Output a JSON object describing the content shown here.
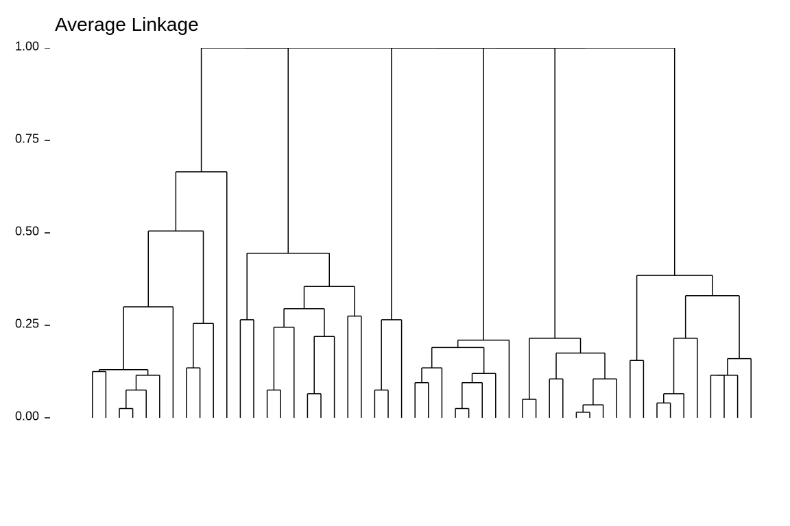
{
  "chart_data": {
    "type": "dendrogram",
    "title": "Average Linkage",
    "ylabel": "",
    "xlabel": "",
    "ylim": [
      0,
      1.0
    ],
    "yticks": [
      0.0,
      0.25,
      0.5,
      0.75,
      1.0
    ],
    "ytick_labels": [
      "0.00",
      "0.25",
      "0.50",
      "0.75",
      "1.00"
    ],
    "n_leaves": 50,
    "merges": [
      {
        "id": "m0",
        "children": [
          "L0",
          "L1"
        ],
        "height": 0.125
      },
      {
        "id": "m1",
        "children": [
          "L2",
          "L3"
        ],
        "height": 0.025
      },
      {
        "id": "m2",
        "children": [
          "m1",
          "L4"
        ],
        "height": 0.075
      },
      {
        "id": "m3",
        "children": [
          "m2",
          "L5"
        ],
        "height": 0.115
      },
      {
        "id": "m4",
        "children": [
          "m0",
          "m3"
        ],
        "height": 0.13
      },
      {
        "id": "m5",
        "children": [
          "m4",
          "L6"
        ],
        "height": 0.3
      },
      {
        "id": "m6",
        "children": [
          "L7",
          "L8"
        ],
        "height": 0.135
      },
      {
        "id": "m7",
        "children": [
          "m6",
          "L9"
        ],
        "height": 0.255
      },
      {
        "id": "m8",
        "children": [
          "m5",
          "m7"
        ],
        "height": 0.505
      },
      {
        "id": "m9",
        "children": [
          "L10",
          "m8"
        ],
        "height": 0.665
      },
      {
        "id": "m10",
        "children": [
          "L11",
          "L12"
        ],
        "height": 0.265
      },
      {
        "id": "m11",
        "children": [
          "L13",
          "L14"
        ],
        "height": 0.075
      },
      {
        "id": "m12",
        "children": [
          "m11",
          "L15"
        ],
        "height": 0.245
      },
      {
        "id": "m13",
        "children": [
          "L16",
          "L17"
        ],
        "height": 0.065
      },
      {
        "id": "m14",
        "children": [
          "m13",
          "L18"
        ],
        "height": 0.22
      },
      {
        "id": "m15",
        "children": [
          "m12",
          "m14"
        ],
        "height": 0.295
      },
      {
        "id": "m16",
        "children": [
          "L19",
          "L20"
        ],
        "height": 0.275
      },
      {
        "id": "m17",
        "children": [
          "m15",
          "m16"
        ],
        "height": 0.355
      },
      {
        "id": "m18",
        "children": [
          "m10",
          "m17"
        ],
        "height": 0.445
      },
      {
        "id": "m19",
        "children": [
          "L21",
          "L22"
        ],
        "height": 0.075
      },
      {
        "id": "m20",
        "children": [
          "m19",
          "L23"
        ],
        "height": 0.265
      },
      {
        "id": "m21",
        "children": [
          "L24",
          "L25"
        ],
        "height": 0.095
      },
      {
        "id": "m22",
        "children": [
          "m21",
          "L26"
        ],
        "height": 0.135
      },
      {
        "id": "m23",
        "children": [
          "L27",
          "L28"
        ],
        "height": 0.025
      },
      {
        "id": "m24",
        "children": [
          "m23",
          "L29"
        ],
        "height": 0.095
      },
      {
        "id": "m25",
        "children": [
          "m24",
          "L30"
        ],
        "height": 0.12
      },
      {
        "id": "m26",
        "children": [
          "m22",
          "m25"
        ],
        "height": 0.19
      },
      {
        "id": "m27",
        "children": [
          "m26",
          "L31"
        ],
        "height": 0.21
      },
      {
        "id": "m28",
        "children": [
          "m20",
          "m27"
        ],
        "height": 1.0
      },
      {
        "id": "m29",
        "children": [
          "L32",
          "L33"
        ],
        "height": 0.05
      },
      {
        "id": "m30",
        "children": [
          "L34",
          "L35"
        ],
        "height": 0.105
      },
      {
        "id": "m31",
        "children": [
          "L36",
          "L37"
        ],
        "height": 0.015
      },
      {
        "id": "m32",
        "children": [
          "m31",
          "L38"
        ],
        "height": 0.035
      },
      {
        "id": "m33",
        "children": [
          "m32",
          "L39"
        ],
        "height": 0.105
      },
      {
        "id": "m34",
        "children": [
          "m30",
          "m33"
        ],
        "height": 0.175
      },
      {
        "id": "m35",
        "children": [
          "m29",
          "m34"
        ],
        "height": 0.215
      },
      {
        "id": "m36",
        "children": [
          "L40",
          "L41"
        ],
        "height": 0.155
      },
      {
        "id": "m37",
        "children": [
          "L42",
          "L43"
        ],
        "height": 0.04
      },
      {
        "id": "m38",
        "children": [
          "m37",
          "L44"
        ],
        "height": 0.065
      },
      {
        "id": "m39",
        "children": [
          "m38",
          "L45"
        ],
        "height": 0.215
      },
      {
        "id": "m40",
        "children": [
          "L46",
          "L47"
        ],
        "height": 0.115
      },
      {
        "id": "m41",
        "children": [
          "m40",
          "L48"
        ],
        "height": 0.115
      },
      {
        "id": "m42",
        "children": [
          "m41",
          "L49"
        ],
        "height": 0.16
      },
      {
        "id": "m43",
        "children": [
          "m39",
          "m42"
        ],
        "height": 0.33
      },
      {
        "id": "m44",
        "children": [
          "m36",
          "m43"
        ],
        "height": 0.385
      },
      {
        "id": "m45",
        "children": [
          "m9",
          "m18"
        ],
        "height": 1.0
      },
      {
        "id": "m46",
        "children": [
          "m28",
          "m35"
        ],
        "height": 1.0
      },
      {
        "id": "m47",
        "children": [
          "m46",
          "m44"
        ],
        "height": 1.0
      },
      {
        "id": "m48",
        "children": [
          "m45",
          "m47"
        ],
        "height": 1.0
      }
    ]
  }
}
